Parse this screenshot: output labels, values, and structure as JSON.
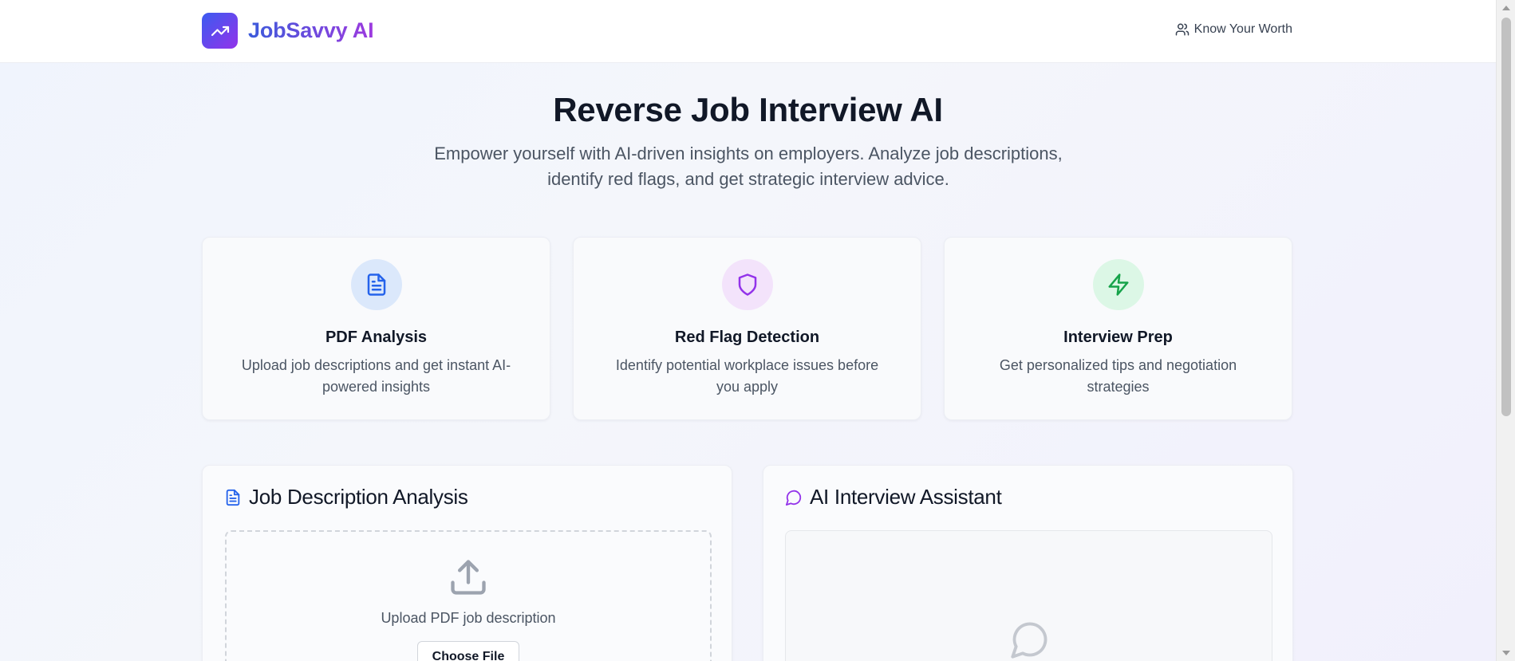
{
  "header": {
    "brand_name": "JobSavvy AI",
    "nav_link": "Know Your Worth",
    "logo_icon": "trending-up-icon",
    "nav_icon": "users-icon"
  },
  "hero": {
    "title": "Reverse Job Interview AI",
    "subtitle": "Empower yourself with AI-driven insights on employers. Analyze job descriptions, identify red flags, and get strategic interview advice."
  },
  "features": [
    {
      "icon": "file-text-icon",
      "title": "PDF Analysis",
      "description": "Upload job descriptions and get instant AI-powered insights",
      "color": "#2563eb",
      "bg": "#dbe8fb"
    },
    {
      "icon": "shield-icon",
      "title": "Red Flag Detection",
      "description": "Identify potential workplace issues before you apply",
      "color": "#9333ea",
      "bg": "#f3e3fb"
    },
    {
      "icon": "zap-icon",
      "title": "Interview Prep",
      "description": "Get personalized tips and negotiation strategies",
      "color": "#16a34a",
      "bg": "#dcf7e6"
    }
  ],
  "analysis": {
    "title": "Job Description Analysis",
    "icon": "file-text-icon",
    "upload_text": "Upload PDF job description",
    "choose_button": "Choose File"
  },
  "assistant": {
    "title": "AI Interview Assistant",
    "icon": "message-circle-icon"
  },
  "colors": {
    "brand_blue": "#3b5bf0",
    "brand_purple": "#9333ea"
  }
}
